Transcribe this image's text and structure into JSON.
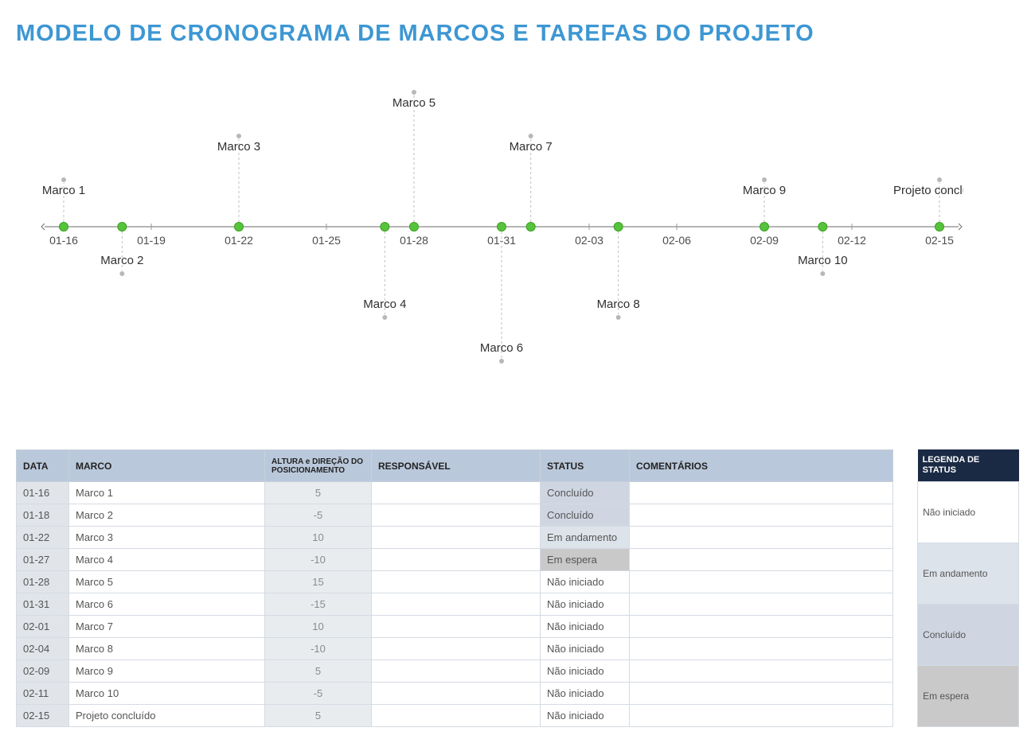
{
  "title": "MODELO DE CRONOGRAMA DE MARCOS E TAREFAS DO PROJETO",
  "chart_data": {
    "type": "timeline-stem",
    "axis_ticks": [
      "01-16",
      "01-19",
      "01-22",
      "01-25",
      "01-28",
      "01-31",
      "02-03",
      "02-06",
      "02-09",
      "02-12",
      "02-15"
    ],
    "x_range": [
      "01-16",
      "02-15"
    ],
    "milestones": [
      {
        "date": "01-16",
        "label": "Marco 1",
        "height": 5
      },
      {
        "date": "01-18",
        "label": "Marco 2",
        "height": -5
      },
      {
        "date": "01-22",
        "label": "Marco 3",
        "height": 10
      },
      {
        "date": "01-27",
        "label": "Marco 4",
        "height": -10
      },
      {
        "date": "01-28",
        "label": "Marco 5",
        "height": 15
      },
      {
        "date": "01-31",
        "label": "Marco 6",
        "height": -15
      },
      {
        "date": "02-01",
        "label": "Marco 7",
        "height": 10
      },
      {
        "date": "02-04",
        "label": "Marco 8",
        "height": -10
      },
      {
        "date": "02-09",
        "label": "Marco 9",
        "height": 5
      },
      {
        "date": "02-11",
        "label": "Marco 10",
        "height": -5
      },
      {
        "date": "02-15",
        "label": "Projeto concluído",
        "height": 5
      }
    ]
  },
  "table": {
    "headers": {
      "data": "DATA",
      "marco": "MARCO",
      "altura": "ALTURA e DIREÇÃO DO POSICIONAMENTO",
      "responsavel": "RESPONSÁVEL",
      "status": "STATUS",
      "comentarios": "COMENTÁRIOS"
    },
    "rows": [
      {
        "data": "01-16",
        "marco": "Marco 1",
        "altura": "5",
        "responsavel": "",
        "status": "Concluído",
        "comentarios": ""
      },
      {
        "data": "01-18",
        "marco": "Marco 2",
        "altura": "-5",
        "responsavel": "",
        "status": "Concluído",
        "comentarios": ""
      },
      {
        "data": "01-22",
        "marco": "Marco 3",
        "altura": "10",
        "responsavel": "",
        "status": "Em andamento",
        "comentarios": ""
      },
      {
        "data": "01-27",
        "marco": "Marco 4",
        "altura": "-10",
        "responsavel": "",
        "status": "Em espera",
        "comentarios": ""
      },
      {
        "data": "01-28",
        "marco": "Marco 5",
        "altura": "15",
        "responsavel": "",
        "status": "Não iniciado",
        "comentarios": ""
      },
      {
        "data": "01-31",
        "marco": "Marco 6",
        "altura": "-15",
        "responsavel": "",
        "status": "Não iniciado",
        "comentarios": ""
      },
      {
        "data": "02-01",
        "marco": "Marco 7",
        "altura": "10",
        "responsavel": "",
        "status": "Não iniciado",
        "comentarios": ""
      },
      {
        "data": "02-04",
        "marco": "Marco 8",
        "altura": "-10",
        "responsavel": "",
        "status": "Não iniciado",
        "comentarios": ""
      },
      {
        "data": "02-09",
        "marco": "Marco 9",
        "altura": "5",
        "responsavel": "",
        "status": "Não iniciado",
        "comentarios": ""
      },
      {
        "data": "02-11",
        "marco": "Marco 10",
        "altura": "-5",
        "responsavel": "",
        "status": "Não iniciado",
        "comentarios": ""
      },
      {
        "data": "02-15",
        "marco": "Projeto concluído",
        "altura": "5",
        "responsavel": "",
        "status": "Não iniciado",
        "comentarios": ""
      }
    ]
  },
  "legend": {
    "header": "LEGENDA DE STATUS",
    "items": [
      {
        "label": "Não iniciado",
        "class": "lg-nao"
      },
      {
        "label": "Em andamento",
        "class": "lg-and"
      },
      {
        "label": "Concluído",
        "class": "lg-con"
      },
      {
        "label": "Em espera",
        "class": "lg-esp"
      }
    ]
  }
}
